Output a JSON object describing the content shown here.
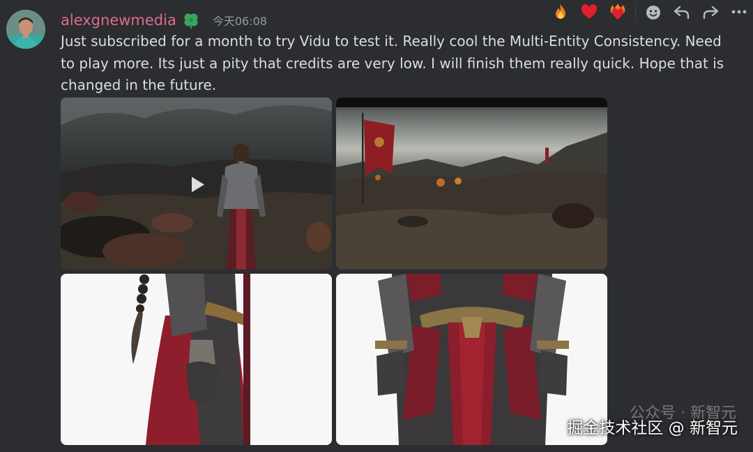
{
  "message": {
    "username": "alexgnewmedia",
    "timestamp": "今天06:08",
    "text": "Just subscribed for a month to try Vidu to test it. Really cool the Multi-Entity Consistency. Need to play more. Its just a pity that credits are very low. I will finish them really quick. Hope that is changed in the future.",
    "badge_icon": "clover-icon",
    "username_color": "#e06c8c"
  },
  "toolbar": {
    "icons": [
      "fire-reaction-icon",
      "heart-reaction-icon",
      "flaming-heart-reaction-icon",
      "add-reaction-icon",
      "reply-icon",
      "forward-icon",
      "more-icon"
    ]
  },
  "attachments": [
    {
      "type": "video",
      "description_icon": "play-icon"
    },
    {
      "type": "image"
    },
    {
      "type": "image"
    },
    {
      "type": "image"
    }
  ],
  "watermark": {
    "faint": "公众号 · 新智元",
    "text": "掘金技术社区 @ 新智元"
  }
}
